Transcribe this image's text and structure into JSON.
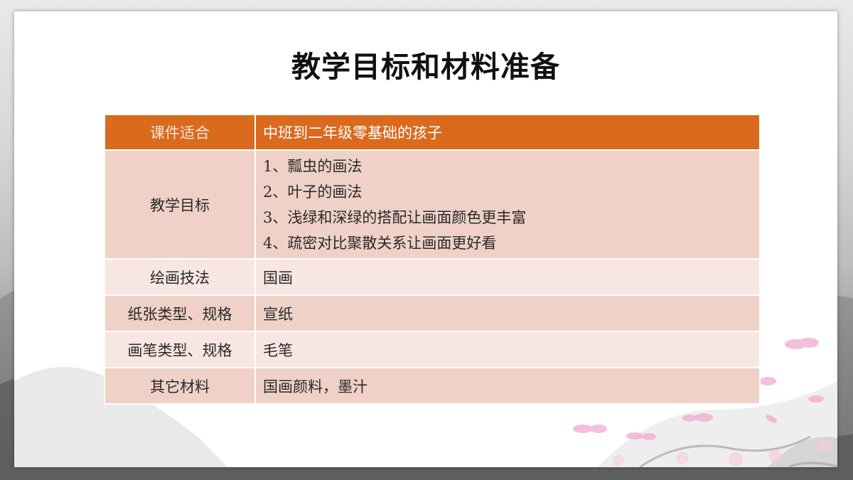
{
  "title": "教学目标和材料准备",
  "table": {
    "header": {
      "label": "课件适合",
      "value": "中班到二年级零基础的孩子"
    },
    "goals": {
      "label": "教学目标",
      "items": [
        "1、瓢虫的画法",
        "2、叶子的画法",
        "3、浅绿和深绿的搭配让画面颜色更丰富",
        "4、疏密对比聚散关系让画面更好看"
      ]
    },
    "rows": [
      {
        "label": "绘画技法",
        "value": "国画"
      },
      {
        "label": "纸张类型、规格",
        "value": "宣纸"
      },
      {
        "label": "画笔类型、规格",
        "value": "毛笔"
      },
      {
        "label": "其它材料",
        "value": "国画颜料，墨汁"
      }
    ]
  },
  "colors": {
    "header_fill": "#d96a1e",
    "row_dark": "#efd1c8",
    "row_light": "#f7e6e2",
    "petal": "#f2a9cf"
  }
}
